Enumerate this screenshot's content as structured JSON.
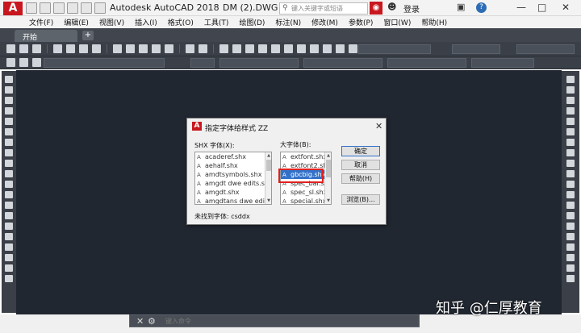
{
  "titlebar": {
    "app_title": "Autodesk AutoCAD 2018",
    "file_title": "DM (2).DWG",
    "search_placeholder": "键入关键字或短语",
    "login_label": "登录",
    "logo_letter": "A"
  },
  "menus": [
    "文件(F)",
    "编辑(E)",
    "视图(V)",
    "插入(I)",
    "格式(O)",
    "工具(T)",
    "绘图(D)",
    "标注(N)",
    "修改(M)",
    "参数(P)",
    "窗口(W)",
    "帮助(H)"
  ],
  "tabs": {
    "start": "开始",
    "add": "+"
  },
  "cmdline": {
    "placeholder": "键入命令"
  },
  "dialog": {
    "title": "指定字体给样式 ZZ",
    "shx_label": "SHX 字体(X):",
    "bigfont_label": "大字体(B):",
    "not_found": "未找到字体: csddx",
    "shx_fonts": [
      "acaderef.shx",
      "aehalf.shx",
      "amdtsymbols.shx",
      "amgdt dwe edits.s",
      "amgdt.shx",
      "amgdtans dwe edi"
    ],
    "big_fonts": [
      "extfont.shx",
      "extfont2.sh",
      "gbcbig.shx",
      "spec_bar.sl",
      "spec_sl.shx",
      "special.shx"
    ],
    "selected_big_font_index": 2,
    "buttons": {
      "ok": "确定",
      "cancel": "取消",
      "help": "帮助(H)",
      "browse": "浏览(B)..."
    }
  },
  "watermark": "知乎 @仁厚教育",
  "colors": {
    "drawing_bg": "#212731",
    "toolbar_bg": "#3b4048",
    "accent_red": "#c8171e",
    "selection_blue": "#3371c9",
    "highlight_red": "#e0201f"
  }
}
